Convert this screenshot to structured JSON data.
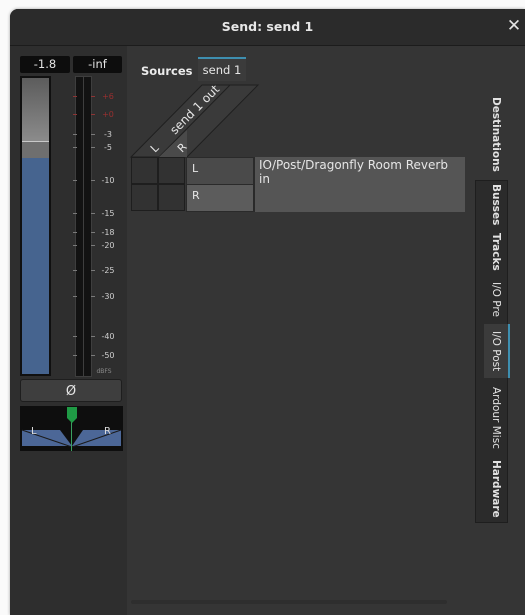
{
  "window": {
    "title": "Send: send 1",
    "close_label": "✕"
  },
  "meter": {
    "gain_value": "-1.8",
    "peak_value": "-inf",
    "gain_fraction": 0.73,
    "scale_labels": [
      {
        "text": "+6",
        "red": true
      },
      {
        "text": "+0",
        "red": true
      },
      {
        "text": "-3",
        "red": false
      },
      {
        "text": "-5",
        "red": false
      },
      {
        "text": "-10",
        "red": false
      },
      {
        "text": "-15",
        "red": false
      },
      {
        "text": "-18",
        "red": false
      },
      {
        "text": "-20",
        "red": false
      },
      {
        "text": "-25",
        "red": false
      },
      {
        "text": "-30",
        "red": false
      },
      {
        "text": "-40",
        "red": false
      },
      {
        "text": "-50",
        "red": false
      }
    ],
    "unit_label": "dBFS"
  },
  "phase_button": {
    "label": "Ø"
  },
  "panner": {
    "left_label": "L",
    "right_label": "R",
    "position": 0.5
  },
  "matrix": {
    "sources_label": "Sources",
    "source_tab": "send 1",
    "source_group": "send 1 out",
    "source_channels": [
      "L",
      "R"
    ],
    "dest_channels": [
      "L",
      "R"
    ],
    "dest_port": "IO/Post/Dragonfly Room Reverb in"
  },
  "dest_tabs": {
    "header": "Destinations",
    "tabs": [
      {
        "label": "Busses",
        "bold": true,
        "active": false
      },
      {
        "label": "Tracks",
        "bold": true,
        "active": false
      },
      {
        "label": "I/O Pre",
        "bold": false,
        "active": false
      },
      {
        "label": "I/O Post",
        "bold": false,
        "active": true
      },
      {
        "label": "Ardour Misc",
        "bold": false,
        "active": false
      },
      {
        "label": "Hardware",
        "bold": true,
        "active": false
      }
    ]
  },
  "colors": {
    "accent": "#3e8fb0",
    "fader_fill": "#46648f",
    "panner_handle": "#1f9a45",
    "panner_wing": "#4c6797"
  }
}
